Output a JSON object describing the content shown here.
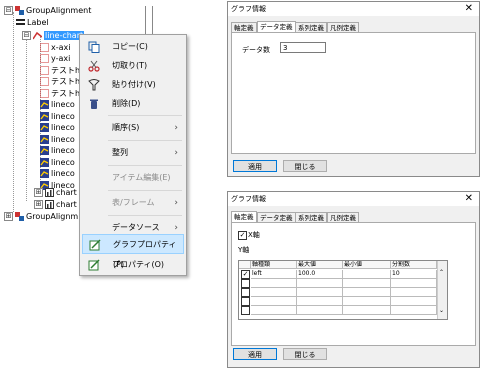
{
  "tree": {
    "nodes": [
      {
        "label": "GroupAlignment",
        "expander": "⊟",
        "icon": "group-alignment-icon"
      },
      {
        "label": "Label",
        "icon": "label-icon"
      },
      {
        "label": "line-chart",
        "expander": "⊟",
        "icon": "line-chart-icon",
        "selected": true
      },
      {
        "label": "x-axi",
        "icon": "axis-icon"
      },
      {
        "label": "y-axi",
        "icon": "axis-icon"
      },
      {
        "label": "テストh",
        "icon": "text-icon"
      },
      {
        "label": "テストh",
        "icon": "text-icon"
      },
      {
        "label": "テストh",
        "icon": "text-icon"
      },
      {
        "label": "lineco",
        "icon": "series-icon"
      },
      {
        "label": "lineco",
        "icon": "series-icon"
      },
      {
        "label": "lineco",
        "icon": "series-icon"
      },
      {
        "label": "lineco",
        "icon": "series-icon"
      },
      {
        "label": "lineco",
        "icon": "series-icon"
      },
      {
        "label": "lineco",
        "icon": "series-icon"
      },
      {
        "label": "lineco",
        "icon": "series-icon"
      },
      {
        "label": "lineco",
        "icon": "series-icon"
      },
      {
        "label": "chart",
        "expander": "⊞",
        "icon": "chart-icon"
      },
      {
        "label": "chart",
        "expander": "⊞",
        "icon": "chart-icon"
      },
      {
        "label": "GroupAlignm",
        "expander": "⊞",
        "icon": "group-alignment-icon"
      }
    ]
  },
  "context_menu": {
    "items": [
      {
        "label": "コピー(C)",
        "icon": "copy-icon"
      },
      {
        "label": "切取り(T)",
        "icon": "cut-icon"
      },
      {
        "label": "貼り付け(V)",
        "icon": "paste-icon"
      },
      {
        "label": "削除(D)",
        "icon": "delete-icon"
      },
      {
        "label": "順序(S)",
        "arrow": "›"
      },
      {
        "label": "整列",
        "arrow": "›"
      },
      {
        "label": "アイテム編集(E)",
        "disabled": true
      },
      {
        "label": "表/フレーム",
        "arrow": "›",
        "disabled": true
      },
      {
        "label": "データソース",
        "arrow": "›"
      },
      {
        "label": "グラフプロパティ(P)",
        "icon": "graph-properties-icon",
        "highlighted": true
      },
      {
        "label": "プロパティ(O)",
        "icon": "properties-icon"
      }
    ]
  },
  "dialog_top": {
    "title": "グラフ情報",
    "close": "✕",
    "tabs": [
      "軸定義",
      "データ定義",
      "系列定義",
      "凡例定義"
    ],
    "active_tab": 1,
    "field_label": "データ数",
    "field_value": "3",
    "apply_label": "適用",
    "close_label": "閉じる"
  },
  "dialog_bottom": {
    "title": "グラフ情報",
    "close": "✕",
    "tabs": [
      "軸定義",
      "データ定義",
      "系列定義",
      "凡例定義"
    ],
    "active_tab": 0,
    "x_axis_checkbox_label": "X軸",
    "x_axis_checked": true,
    "y_axis_label": "Y軸",
    "columns": [
      "軸種類",
      "最大値",
      "最小値",
      "分割数"
    ],
    "rows": [
      {
        "checked": true,
        "type": "left",
        "max": "100.0",
        "min": "",
        "divisions": "10"
      },
      {
        "checked": false,
        "type": "",
        "max": "",
        "min": "",
        "divisions": ""
      },
      {
        "checked": false,
        "type": "",
        "max": "",
        "min": "",
        "divisions": ""
      },
      {
        "checked": false,
        "type": "",
        "max": "",
        "min": "",
        "divisions": ""
      },
      {
        "checked": false,
        "type": "",
        "max": "",
        "min": "",
        "divisions": ""
      }
    ],
    "apply_label": "適用",
    "close_label": "閉じる"
  },
  "colors": {
    "selection": "#3399ff",
    "menu_highlight": "#cce8ff",
    "default_button_border": "#0078d7"
  }
}
